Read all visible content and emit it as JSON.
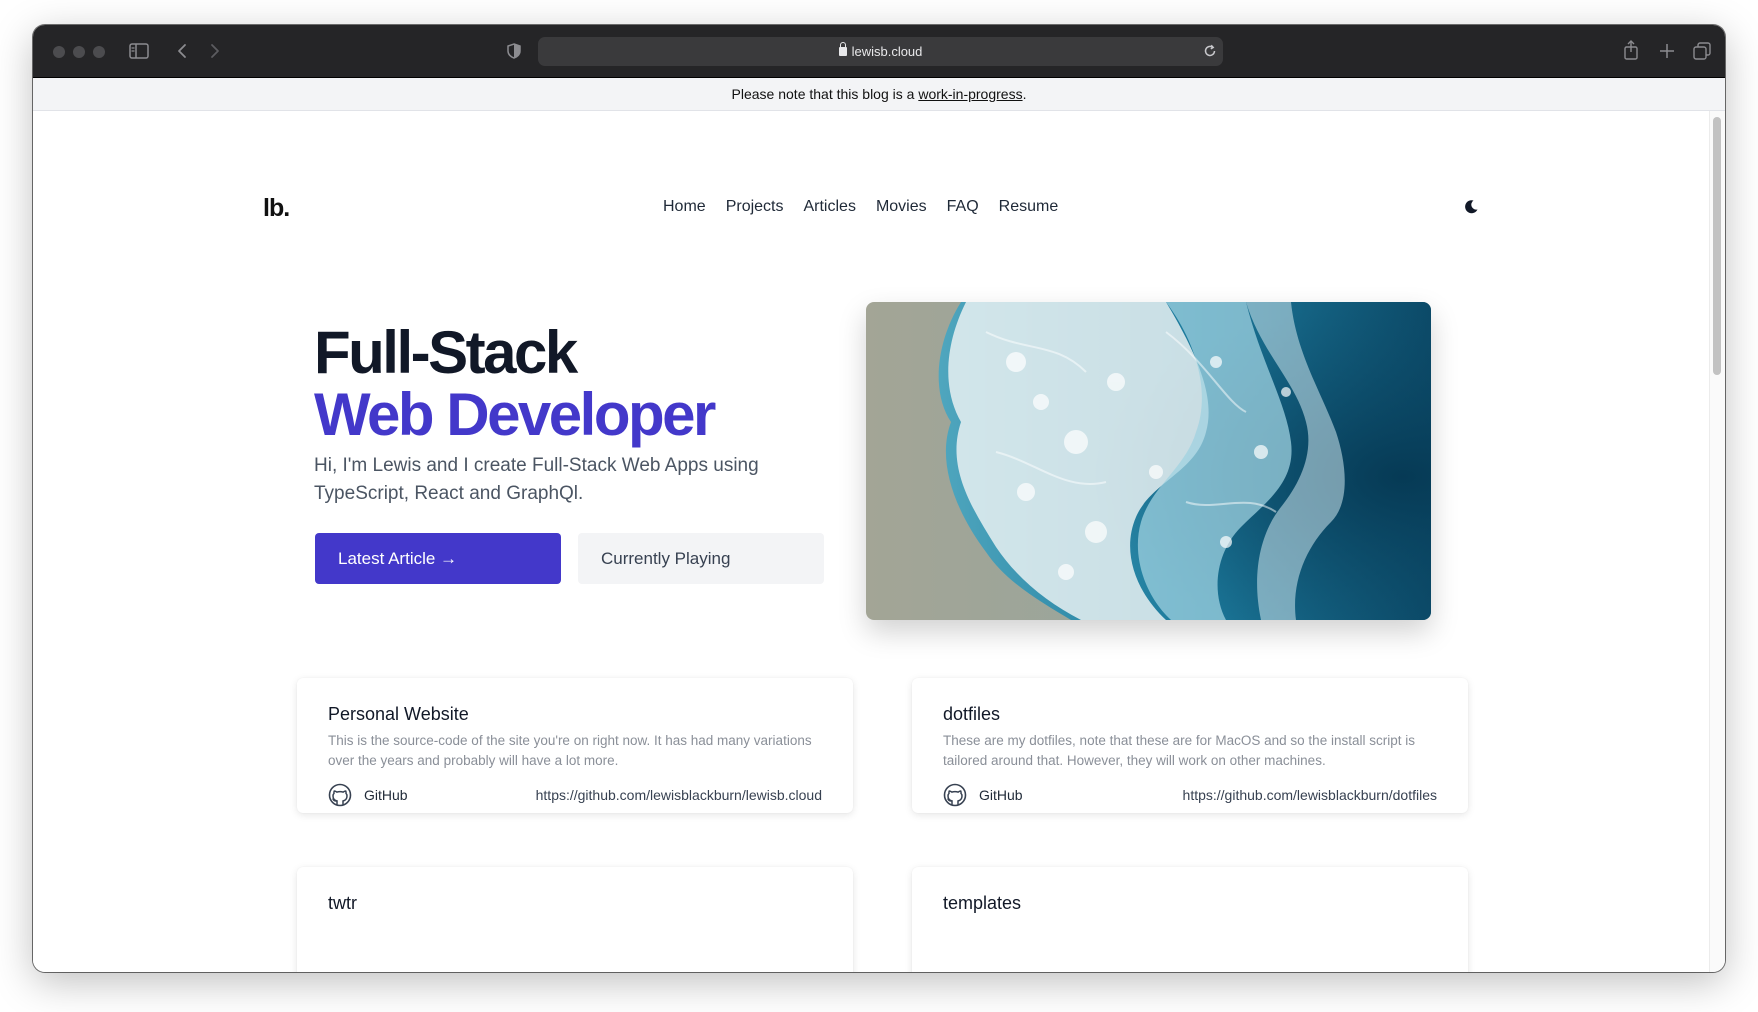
{
  "browser": {
    "url": "lewisb.cloud"
  },
  "banner": {
    "text_before": "Please note that this blog is a ",
    "link": "work-in-progress",
    "text_after": "."
  },
  "site": {
    "logo": "lb.",
    "nav": [
      "Home",
      "Projects",
      "Articles",
      "Movies",
      "FAQ",
      "Resume"
    ],
    "theme_toggle_icon": "moon-icon"
  },
  "hero": {
    "title_line1": "Full-Stack",
    "title_line2": "Web Developer",
    "subtitle": "Hi, I'm Lewis and I create Full-Stack Web Apps using TypeScript, React and GraphQl.",
    "primary_button": "Latest Article →",
    "secondary_button": "Currently Playing"
  },
  "projects": [
    {
      "title": "Personal Website",
      "description": "This is the source-code of the site you're on right now. It has had many variations over the years and probably will have a lot more.",
      "link_label": "GitHub",
      "url": "https://github.com/lewisblackburn/lewisb.cloud"
    },
    {
      "title": "dotfiles",
      "description": "These are my dotfiles, note that these are for MacOS and so the install script is tailored around that. However, they will work on other machines.",
      "link_label": "GitHub",
      "url": "https://github.com/lewisblackburn/dotfiles"
    },
    {
      "title": "twtr",
      "description": "",
      "link_label": "",
      "url": ""
    },
    {
      "title": "templates",
      "description": "",
      "link_label": "",
      "url": ""
    }
  ],
  "colors": {
    "accent": "#4338ca",
    "toolbar": "#252527",
    "banner_bg": "#f3f4f6"
  }
}
